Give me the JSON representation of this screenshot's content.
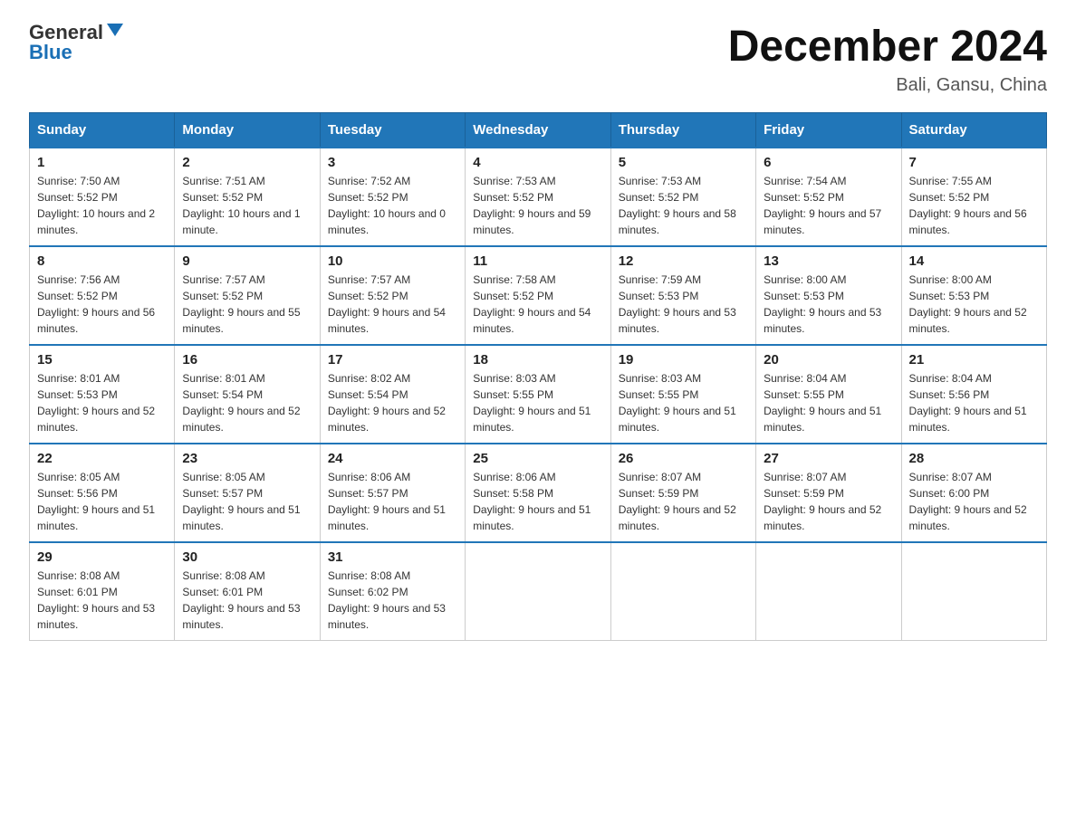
{
  "header": {
    "logo_general": "General",
    "logo_blue": "Blue",
    "main_title": "December 2024",
    "subtitle": "Bali, Gansu, China"
  },
  "weekdays": [
    "Sunday",
    "Monday",
    "Tuesday",
    "Wednesday",
    "Thursday",
    "Friday",
    "Saturday"
  ],
  "weeks": [
    [
      {
        "day": "1",
        "sunrise": "7:50 AM",
        "sunset": "5:52 PM",
        "daylight": "10 hours and 2 minutes."
      },
      {
        "day": "2",
        "sunrise": "7:51 AM",
        "sunset": "5:52 PM",
        "daylight": "10 hours and 1 minute."
      },
      {
        "day": "3",
        "sunrise": "7:52 AM",
        "sunset": "5:52 PM",
        "daylight": "10 hours and 0 minutes."
      },
      {
        "day": "4",
        "sunrise": "7:53 AM",
        "sunset": "5:52 PM",
        "daylight": "9 hours and 59 minutes."
      },
      {
        "day": "5",
        "sunrise": "7:53 AM",
        "sunset": "5:52 PM",
        "daylight": "9 hours and 58 minutes."
      },
      {
        "day": "6",
        "sunrise": "7:54 AM",
        "sunset": "5:52 PM",
        "daylight": "9 hours and 57 minutes."
      },
      {
        "day": "7",
        "sunrise": "7:55 AM",
        "sunset": "5:52 PM",
        "daylight": "9 hours and 56 minutes."
      }
    ],
    [
      {
        "day": "8",
        "sunrise": "7:56 AM",
        "sunset": "5:52 PM",
        "daylight": "9 hours and 56 minutes."
      },
      {
        "day": "9",
        "sunrise": "7:57 AM",
        "sunset": "5:52 PM",
        "daylight": "9 hours and 55 minutes."
      },
      {
        "day": "10",
        "sunrise": "7:57 AM",
        "sunset": "5:52 PM",
        "daylight": "9 hours and 54 minutes."
      },
      {
        "day": "11",
        "sunrise": "7:58 AM",
        "sunset": "5:52 PM",
        "daylight": "9 hours and 54 minutes."
      },
      {
        "day": "12",
        "sunrise": "7:59 AM",
        "sunset": "5:53 PM",
        "daylight": "9 hours and 53 minutes."
      },
      {
        "day": "13",
        "sunrise": "8:00 AM",
        "sunset": "5:53 PM",
        "daylight": "9 hours and 53 minutes."
      },
      {
        "day": "14",
        "sunrise": "8:00 AM",
        "sunset": "5:53 PM",
        "daylight": "9 hours and 52 minutes."
      }
    ],
    [
      {
        "day": "15",
        "sunrise": "8:01 AM",
        "sunset": "5:53 PM",
        "daylight": "9 hours and 52 minutes."
      },
      {
        "day": "16",
        "sunrise": "8:01 AM",
        "sunset": "5:54 PM",
        "daylight": "9 hours and 52 minutes."
      },
      {
        "day": "17",
        "sunrise": "8:02 AM",
        "sunset": "5:54 PM",
        "daylight": "9 hours and 52 minutes."
      },
      {
        "day": "18",
        "sunrise": "8:03 AM",
        "sunset": "5:55 PM",
        "daylight": "9 hours and 51 minutes."
      },
      {
        "day": "19",
        "sunrise": "8:03 AM",
        "sunset": "5:55 PM",
        "daylight": "9 hours and 51 minutes."
      },
      {
        "day": "20",
        "sunrise": "8:04 AM",
        "sunset": "5:55 PM",
        "daylight": "9 hours and 51 minutes."
      },
      {
        "day": "21",
        "sunrise": "8:04 AM",
        "sunset": "5:56 PM",
        "daylight": "9 hours and 51 minutes."
      }
    ],
    [
      {
        "day": "22",
        "sunrise": "8:05 AM",
        "sunset": "5:56 PM",
        "daylight": "9 hours and 51 minutes."
      },
      {
        "day": "23",
        "sunrise": "8:05 AM",
        "sunset": "5:57 PM",
        "daylight": "9 hours and 51 minutes."
      },
      {
        "day": "24",
        "sunrise": "8:06 AM",
        "sunset": "5:57 PM",
        "daylight": "9 hours and 51 minutes."
      },
      {
        "day": "25",
        "sunrise": "8:06 AM",
        "sunset": "5:58 PM",
        "daylight": "9 hours and 51 minutes."
      },
      {
        "day": "26",
        "sunrise": "8:07 AM",
        "sunset": "5:59 PM",
        "daylight": "9 hours and 52 minutes."
      },
      {
        "day": "27",
        "sunrise": "8:07 AM",
        "sunset": "5:59 PM",
        "daylight": "9 hours and 52 minutes."
      },
      {
        "day": "28",
        "sunrise": "8:07 AM",
        "sunset": "6:00 PM",
        "daylight": "9 hours and 52 minutes."
      }
    ],
    [
      {
        "day": "29",
        "sunrise": "8:08 AM",
        "sunset": "6:01 PM",
        "daylight": "9 hours and 53 minutes."
      },
      {
        "day": "30",
        "sunrise": "8:08 AM",
        "sunset": "6:01 PM",
        "daylight": "9 hours and 53 minutes."
      },
      {
        "day": "31",
        "sunrise": "8:08 AM",
        "sunset": "6:02 PM",
        "daylight": "9 hours and 53 minutes."
      },
      null,
      null,
      null,
      null
    ]
  ]
}
